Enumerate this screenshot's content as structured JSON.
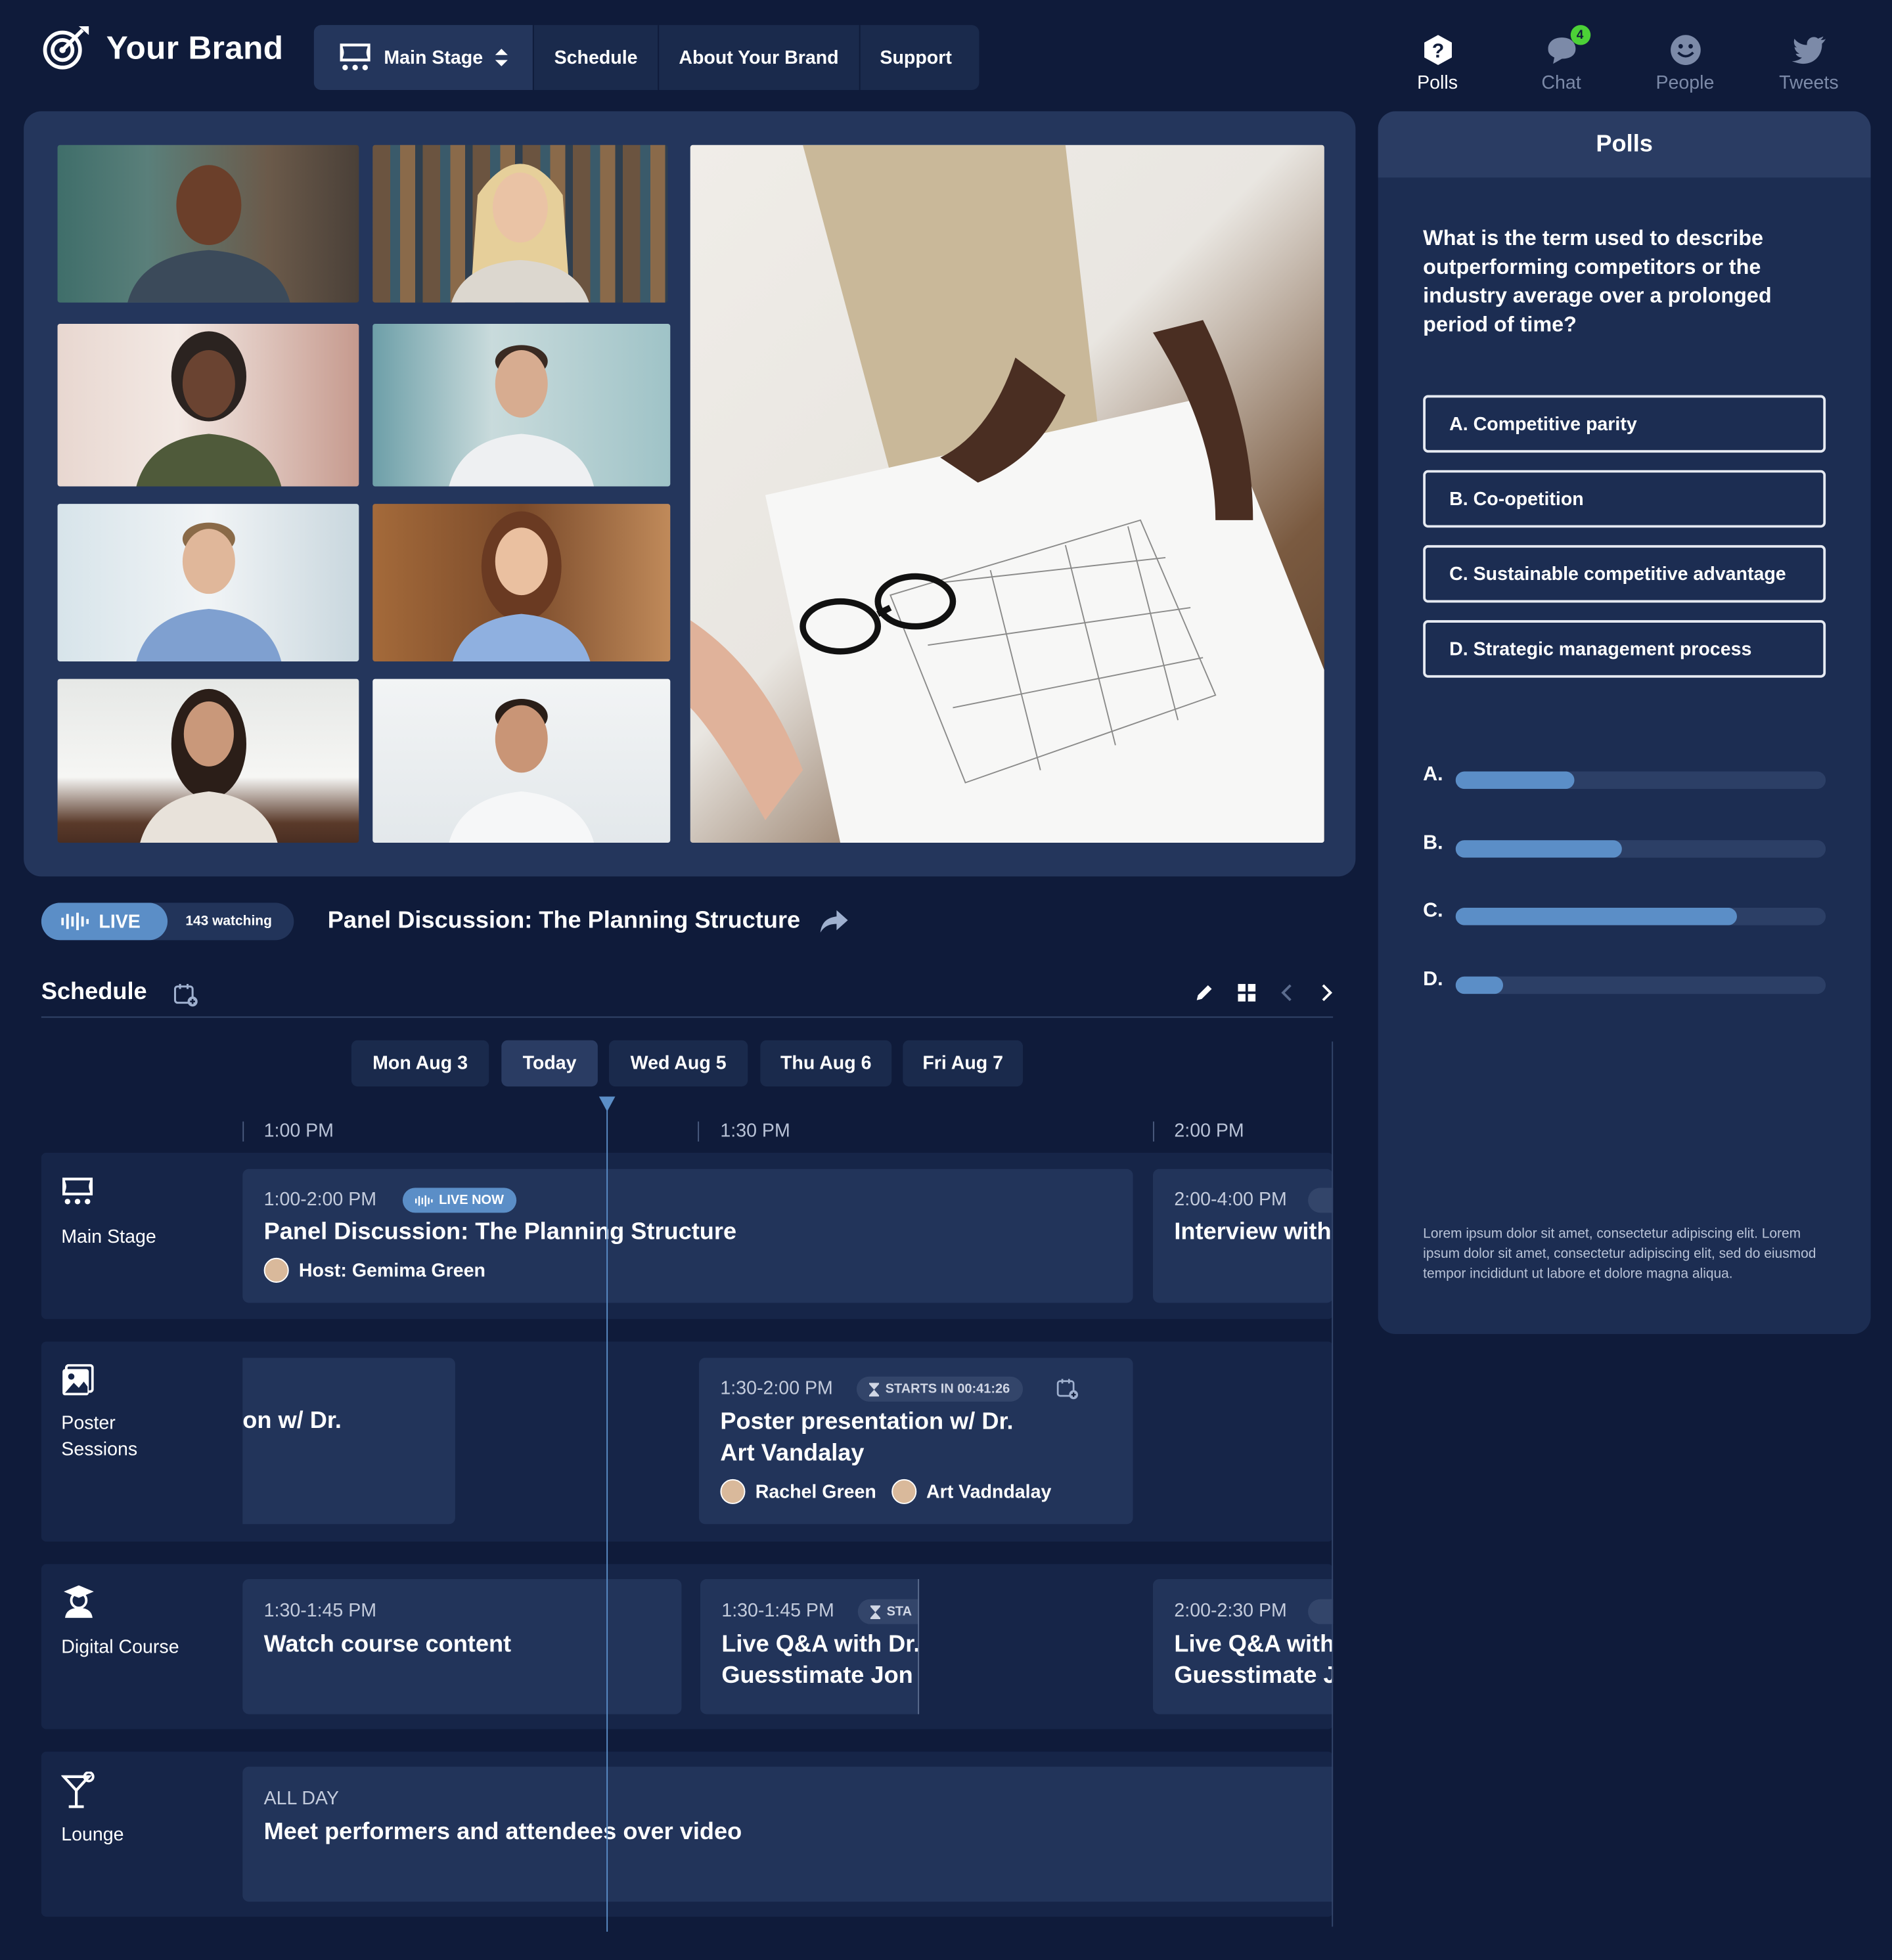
{
  "header": {
    "brand": "Your Brand",
    "nav": [
      {
        "label": "Main Stage"
      },
      {
        "label": "Schedule"
      },
      {
        "label": "About Your Brand"
      },
      {
        "label": "Support"
      }
    ],
    "tabs": [
      {
        "label": "Polls",
        "icon": "question-icon",
        "active": true
      },
      {
        "label": "Chat",
        "icon": "chat-icon",
        "badge": "4"
      },
      {
        "label": "People",
        "icon": "smiley-icon"
      },
      {
        "label": "Tweets",
        "icon": "twitter-icon"
      }
    ]
  },
  "live": {
    "label": "LIVE",
    "watching": "143 watching",
    "title": "Panel Discussion: The Planning Structure"
  },
  "schedule": {
    "title": "Schedule",
    "days": [
      "Mon Aug 3",
      "Today",
      "Wed Aug 5",
      "Thu Aug 6",
      "Fri Aug 7"
    ],
    "times": [
      "1:00 PM",
      "1:30 PM",
      "2:00 PM"
    ],
    "rows": [
      {
        "label": "Main Stage",
        "events": [
          {
            "time": "1:00-2:00 PM",
            "pill": "LIVE NOW",
            "name": "Panel Discussion: The Planning Structure",
            "host": "Host: Gemima Green"
          },
          {
            "time": "2:00-4:00 PM",
            "name": "Interview with"
          }
        ]
      },
      {
        "label": "Poster Sessions",
        "events": [
          {
            "name": "on w/ Dr."
          },
          {
            "time": "1:30-2:00 PM",
            "pill": "STARTS IN 00:41:26",
            "name1": "Poster presentation w/ Dr.",
            "name2": "Art Vandalay",
            "host1": "Rachel Green",
            "host2": "Art Vadndalay"
          }
        ]
      },
      {
        "label": "Digital Course",
        "events": [
          {
            "time": "1:30-1:45 PM",
            "name": "Watch course content"
          },
          {
            "time": "1:30-1:45 PM",
            "pill": "STA",
            "name1": "Live Q&A with Dr.",
            "name2": "Guesstimate Jon"
          },
          {
            "time": "2:00-2:30 PM",
            "name1": "Live Q&A with",
            "name2": "Guesstimate J"
          }
        ]
      },
      {
        "label": "Lounge",
        "events": [
          {
            "time": "ALL DAY",
            "name": "Meet performers and attendees over video"
          }
        ]
      }
    ]
  },
  "polls": {
    "title": "Polls",
    "question": "What is the term used to describe outperforming competitors or the industry average over a prolonged period of time?",
    "options": [
      "A. Competitive parity",
      "B. Co-opetition",
      "C. Sustainable competitive advantage",
      "D. Strategic management process"
    ],
    "results": [
      {
        "label": "A.",
        "value": 0.32
      },
      {
        "label": "B.",
        "value": 0.45
      },
      {
        "label": "C.",
        "value": 0.76
      },
      {
        "label": "D.",
        "value": 0.13
      }
    ],
    "footnote": "Lorem ipsum dolor sit amet, consectetur adipiscing elit. Lorem ipsum dolor sit amet, consectetur adipiscing elit, sed do eiusmod tempor incididunt ut labore et dolore magna aliqua."
  },
  "colors": {
    "background": "#0f1b3a",
    "accent": "#5b8ec7",
    "panel": "#24365c",
    "badge": "#4cd137"
  }
}
